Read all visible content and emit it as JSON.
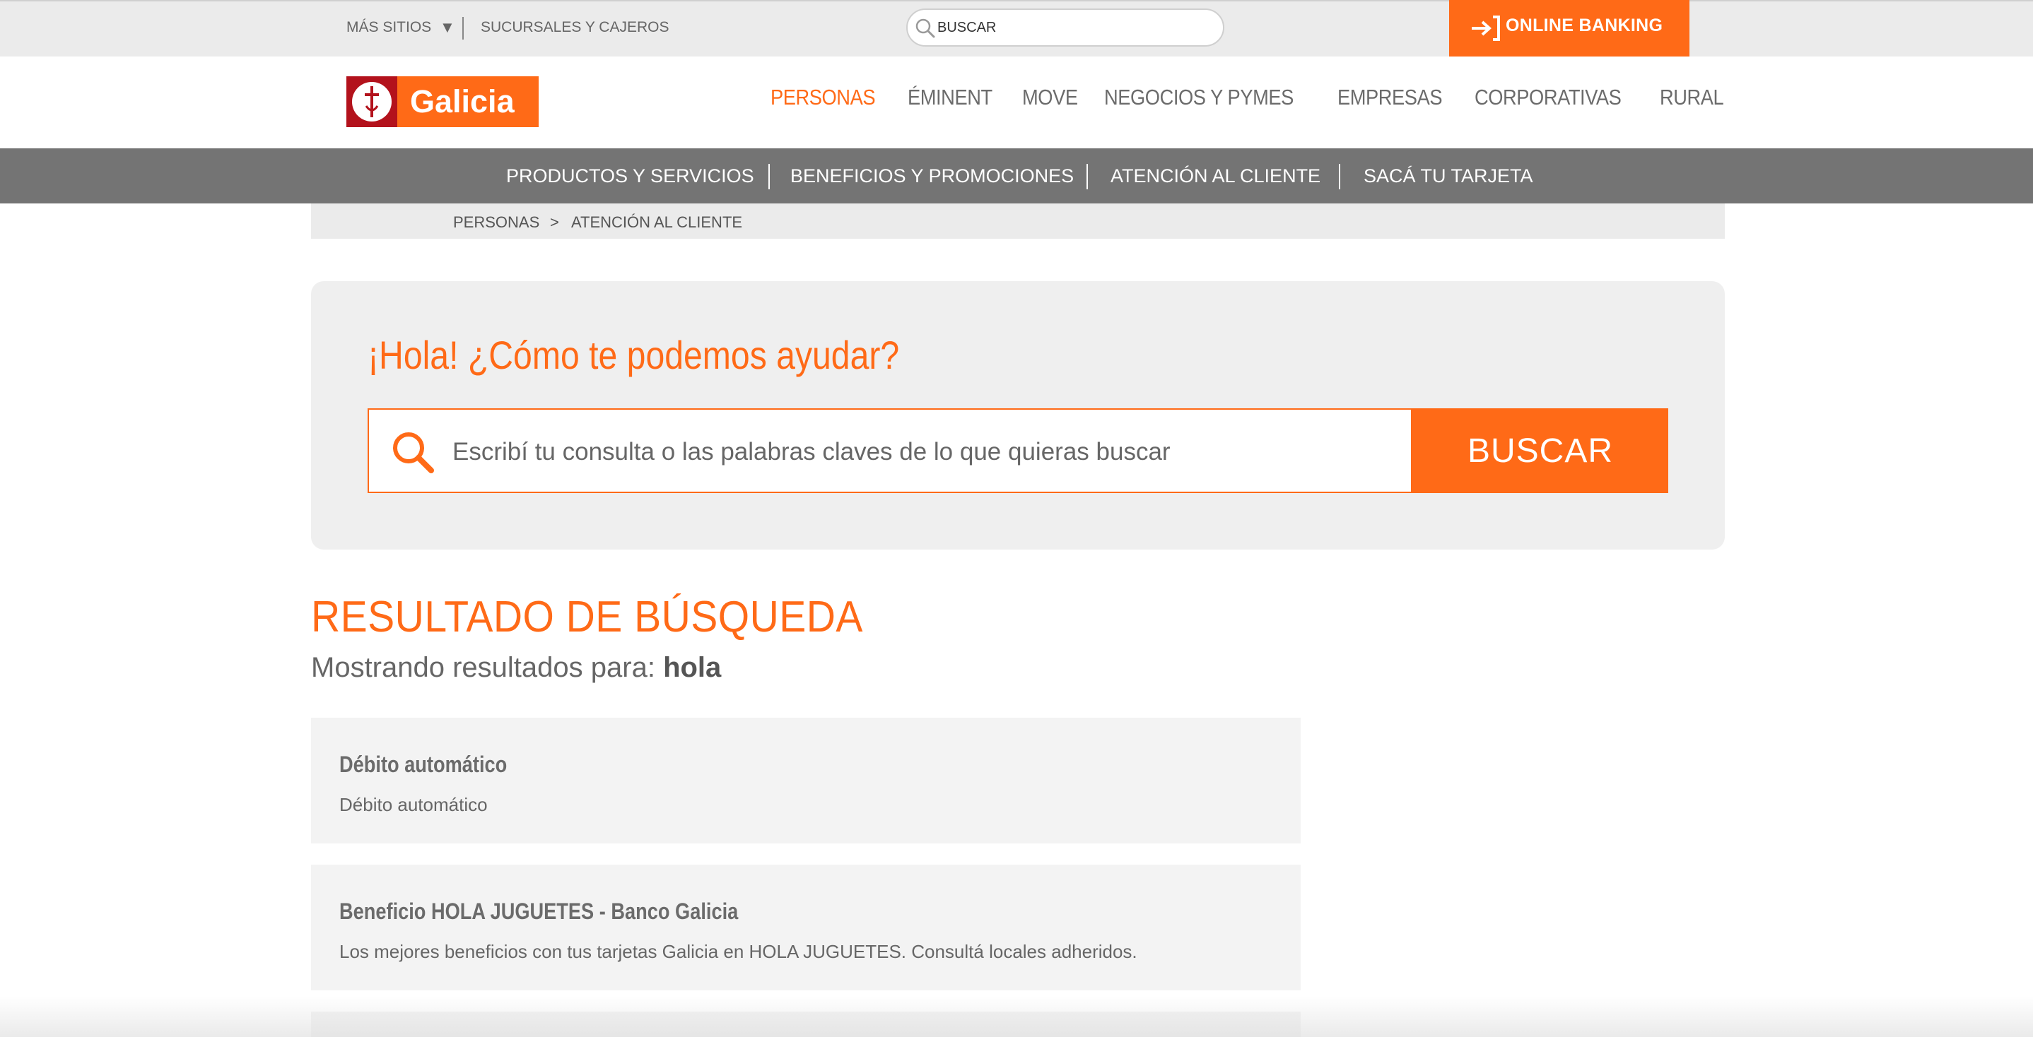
{
  "topbar": {
    "mas_sitios": "MÁS SITIOS",
    "sucursales": "SUCURSALES Y CAJEROS",
    "search_placeholder": "BUSCAR",
    "online_banking": "ONLINE BANKING"
  },
  "logo": {
    "text": "Galicia"
  },
  "main_nav": [
    {
      "label": "PERSONAS",
      "active": true
    },
    {
      "label": "ÉMINENT"
    },
    {
      "label": "MOVE"
    },
    {
      "label": "NEGOCIOS Y PYMES"
    },
    {
      "label": "EMPRESAS"
    },
    {
      "label": "CORPORATIVAS"
    },
    {
      "label": "RURAL"
    }
  ],
  "sub_nav": [
    {
      "label": "PRODUCTOS Y SERVICIOS"
    },
    {
      "label": "BENEFICIOS Y PROMOCIONES"
    },
    {
      "label": "ATENCIÓN AL CLIENTE"
    },
    {
      "label": "SACÁ TU TARJETA"
    }
  ],
  "breadcrumb": {
    "items": [
      "PERSONAS",
      "ATENCIÓN AL CLIENTE"
    ],
    "separator": ">"
  },
  "help": {
    "title": "¡Hola! ¿Cómo te podemos ayudar?",
    "placeholder": "Escribí tu consulta o las palabras claves de lo que quieras buscar",
    "button": "BUSCAR"
  },
  "results": {
    "title": "RESULTADO DE BÚSQUEDA",
    "showing_label": "Mostrando resultados para:",
    "query": "hola",
    "items": [
      {
        "title": "Débito automático",
        "description": "Débito automático"
      },
      {
        "title": "Beneficio HOLA JUGUETES - Banco Galicia",
        "description": "Los mejores beneficios con tus tarjetas Galicia en HOLA JUGUETES. Consultá locales adheridos."
      }
    ]
  },
  "colors": {
    "brand_orange": "#ff6a17",
    "brand_red": "#b3121c",
    "subnav_gray": "#747474",
    "panel_gray": "#efefef"
  }
}
